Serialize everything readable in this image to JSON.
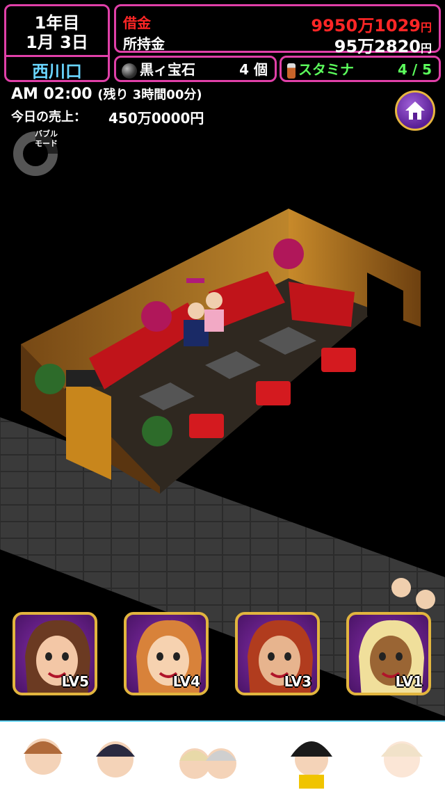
{
  "status": {
    "year": "1年目",
    "date": "1月 3日",
    "location": "西川口",
    "debt_label": "借金",
    "debt_value": "9950万1029",
    "cash_label": "所持金",
    "cash_value": "95万2820",
    "yen": "円"
  },
  "items": {
    "jewel_label": "黒ィ宝石",
    "jewel_count": "4 個",
    "stamina_label": "スタミナ",
    "stamina_value": "4 / 5"
  },
  "time": {
    "clock": "AM 02:00",
    "remaining": "(残り 3時間00分)",
    "sales_label": "今日の売上：",
    "sales_value": "450万0000円"
  },
  "bubble_mode": {
    "label_line1": "バブル",
    "label_line2": "モード"
  },
  "hostesses": [
    {
      "level": "LV5",
      "hair": "#6b3a22",
      "skin": "#f3c7a6"
    },
    {
      "level": "LV4",
      "hair": "#d8823a",
      "skin": "#f6d2b0"
    },
    {
      "level": "LV3",
      "hair": "#b13c1e",
      "skin": "#e7b48e"
    },
    {
      "level": "LV1",
      "hair": "#f0df9b",
      "skin": "#9a6534"
    }
  ],
  "icons": {
    "home": "home-icon",
    "gem": "black-gem-icon",
    "stamina": "drink-bottle-icon"
  },
  "colors": {
    "frame": "#e040a8",
    "debt": "#ff2626",
    "stamina": "#5cff5c",
    "location": "#6ad6ff"
  }
}
